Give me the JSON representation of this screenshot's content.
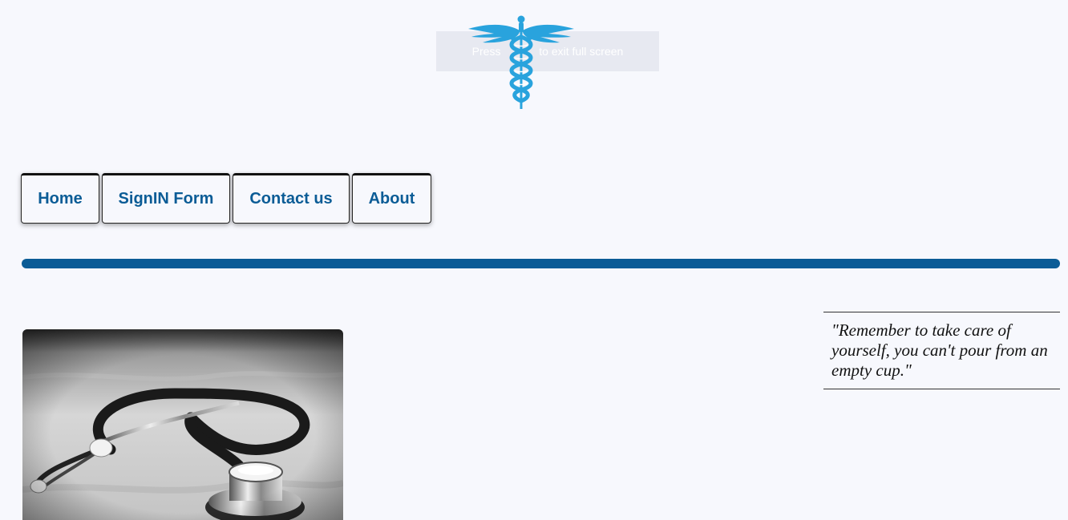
{
  "fullscreen_notice": {
    "text_before": "Press",
    "text_after": "to exit full screen"
  },
  "logo": {
    "icon": "caduceus-icon",
    "color": "#29a3dd"
  },
  "nav": {
    "items": [
      {
        "label": "Home"
      },
      {
        "label": "SignIN Form"
      },
      {
        "label": "Contact us"
      },
      {
        "label": "About"
      }
    ]
  },
  "colors": {
    "accent": "#0b5c96",
    "background": "#f7f8fd",
    "logo": "#29a3dd"
  },
  "quote": {
    "text": "\"Remember to take care of yourself, you can't pour from an empty cup.\""
  },
  "image": {
    "subject": "stethoscope-photo"
  }
}
